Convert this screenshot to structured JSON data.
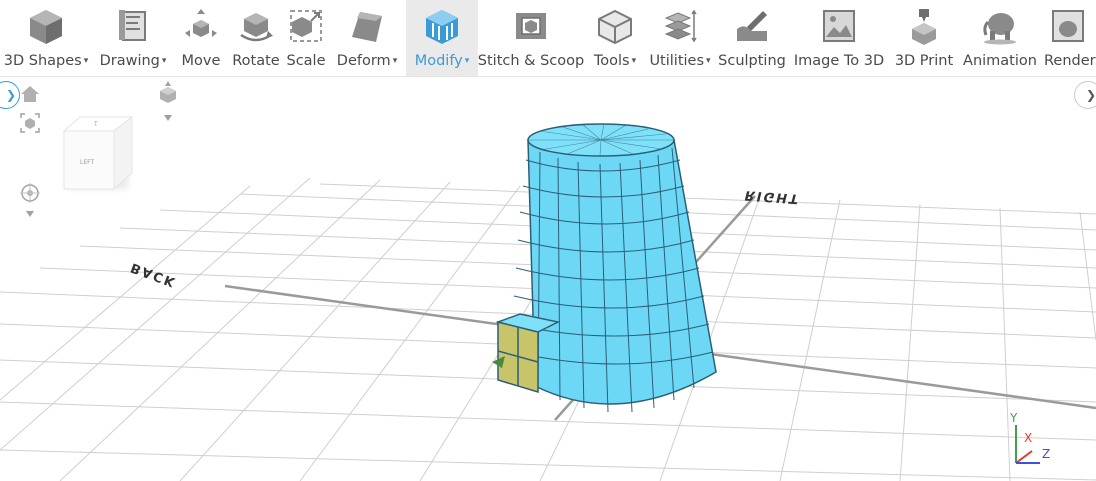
{
  "toolbar": {
    "items": [
      {
        "label": "3D Shapes",
        "dropdown": true,
        "icon": "cube-icon"
      },
      {
        "label": "Drawing",
        "dropdown": true,
        "icon": "drawing-icon"
      },
      {
        "label": "Move",
        "dropdown": false,
        "icon": "move-icon"
      },
      {
        "label": "Rotate",
        "dropdown": false,
        "icon": "rotate-icon"
      },
      {
        "label": "Scale",
        "dropdown": false,
        "icon": "scale-icon"
      },
      {
        "label": "Deform",
        "dropdown": true,
        "icon": "deform-icon"
      },
      {
        "label": "Modify",
        "dropdown": true,
        "icon": "modify-icon",
        "active": true
      },
      {
        "label": "Stitch & Scoop",
        "dropdown": false,
        "icon": "stitch-scoop-icon"
      },
      {
        "label": "Tools",
        "dropdown": true,
        "icon": "tools-icon"
      },
      {
        "label": "Utilities",
        "dropdown": true,
        "icon": "utilities-icon"
      },
      {
        "label": "Sculpting",
        "dropdown": false,
        "icon": "sculpting-icon"
      },
      {
        "label": "Image To 3D",
        "dropdown": false,
        "icon": "image-to-3d-icon"
      },
      {
        "label": "3D Print",
        "dropdown": false,
        "icon": "3d-print-icon"
      },
      {
        "label": "Animation",
        "dropdown": false,
        "icon": "animation-icon"
      },
      {
        "label": "Render",
        "dropdown": false,
        "icon": "render-icon"
      }
    ],
    "caret_glyph": "▾"
  },
  "viewport": {
    "view_cube_face_left": "LEFT",
    "view_cube_face_top": "T",
    "grid_label_right": "RIGHT",
    "grid_label_back": "BACK",
    "axis_x": "X",
    "axis_y": "Y",
    "axis_z": "Z",
    "left_expand_glyph": "❯",
    "right_expand_glyph": "❯"
  },
  "colors": {
    "accent": "#3a9bd6",
    "model_fill": "#6dd8f5",
    "model_edge": "#2b5f78",
    "selection_fill": "#c8c46a",
    "axis_x": "#e53935",
    "axis_y": "#43a047",
    "axis_z": "#3f51d6"
  }
}
